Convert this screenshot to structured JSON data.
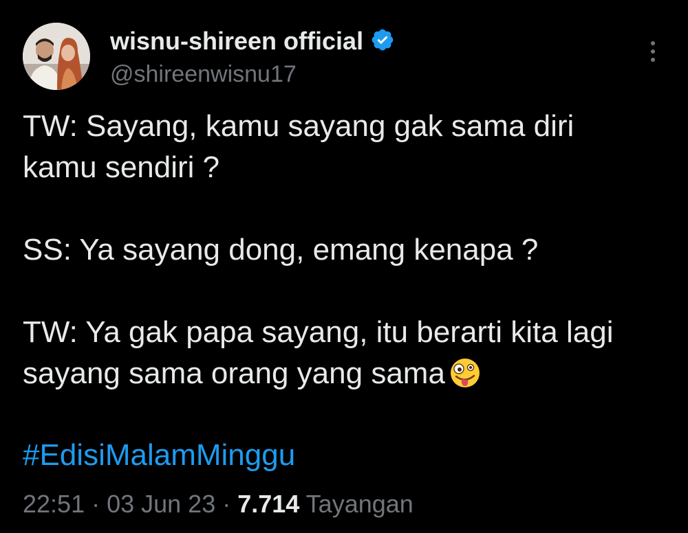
{
  "author": {
    "display_name": "wisnu-shireen official",
    "handle": "@shireenwisnu17",
    "verified_color": "#1d9bf0"
  },
  "tweet": {
    "lines": [
      "TW: Sayang, kamu sayang gak sama diri",
      "kamu sendiri ?",
      "SS: Ya sayang dong, emang kenapa ?",
      "TW: Ya gak papa sayang, itu berarti kita lagi",
      "sayang sama orang yang sama"
    ],
    "emoji": "zany-face-emoji",
    "hashtag": "#EdisiMalamMinggu"
  },
  "meta": {
    "time": "22:51",
    "separator": " · ",
    "date": "03 Jun 23",
    "views_count": "7.714",
    "views_label": " Tayangan"
  },
  "colors": {
    "background": "#000000",
    "text": "#e7e9ea",
    "secondary": "#71767b",
    "link": "#1d9bf0"
  }
}
